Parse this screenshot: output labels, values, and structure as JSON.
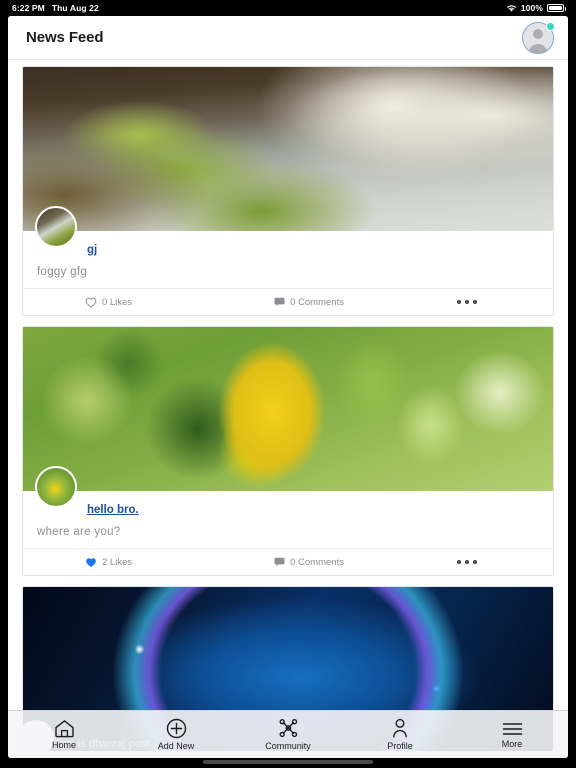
{
  "statusbar": {
    "time": "6:22 PM",
    "date": "Thu Aug 22",
    "battery_percent": "100%",
    "wifi_icon": "wifi-icon",
    "battery_icon": "battery-full-icon"
  },
  "header": {
    "title": "News Feed",
    "avatar_icon": "user-avatar-placeholder-icon",
    "online_badge_color": "#3ad6c0",
    "avatar_border_color": "#7fa8d4"
  },
  "feed": {
    "posts": [
      {
        "username": "gj",
        "caption": "foggy gfg",
        "likes_label": "0 Likes",
        "comments_label": "0 Comments",
        "liked": false,
        "like_icon": "heart-outline-icon",
        "comment_icon": "comment-bubble-icon",
        "more_icon": "ellipsis-icon",
        "image_alt": "waterfall-landscape"
      },
      {
        "username": "hello bro.",
        "caption": "where are you?",
        "likes_label": "2 Likes",
        "comments_label": "0 Comments",
        "liked": true,
        "like_icon": "heart-filled-icon",
        "comment_icon": "comment-bubble-icon",
        "more_icon": "ellipsis-icon",
        "image_alt": "yellow-leaf-foliage"
      },
      {
        "username": "",
        "caption": "This is dhanraj post",
        "likes_label": "",
        "comments_label": "",
        "liked": false,
        "like_icon": "heart-outline-icon",
        "comment_icon": "comment-bubble-icon",
        "more_icon": "ellipsis-icon",
        "image_alt": "blue-glowing-ring-abstract"
      }
    ],
    "link_color": "#1b4fa0",
    "liked_color": "#1878f2",
    "muted_text_color": "#8e8e93"
  },
  "tabbar": {
    "items": [
      {
        "label": "Home",
        "icon": "home-icon"
      },
      {
        "label": "Add New",
        "icon": "plus-circle-icon"
      },
      {
        "label": "Community",
        "icon": "share-network-icon"
      },
      {
        "label": "Profile",
        "icon": "person-icon"
      },
      {
        "label": "More",
        "icon": "hamburger-menu-icon"
      }
    ]
  }
}
